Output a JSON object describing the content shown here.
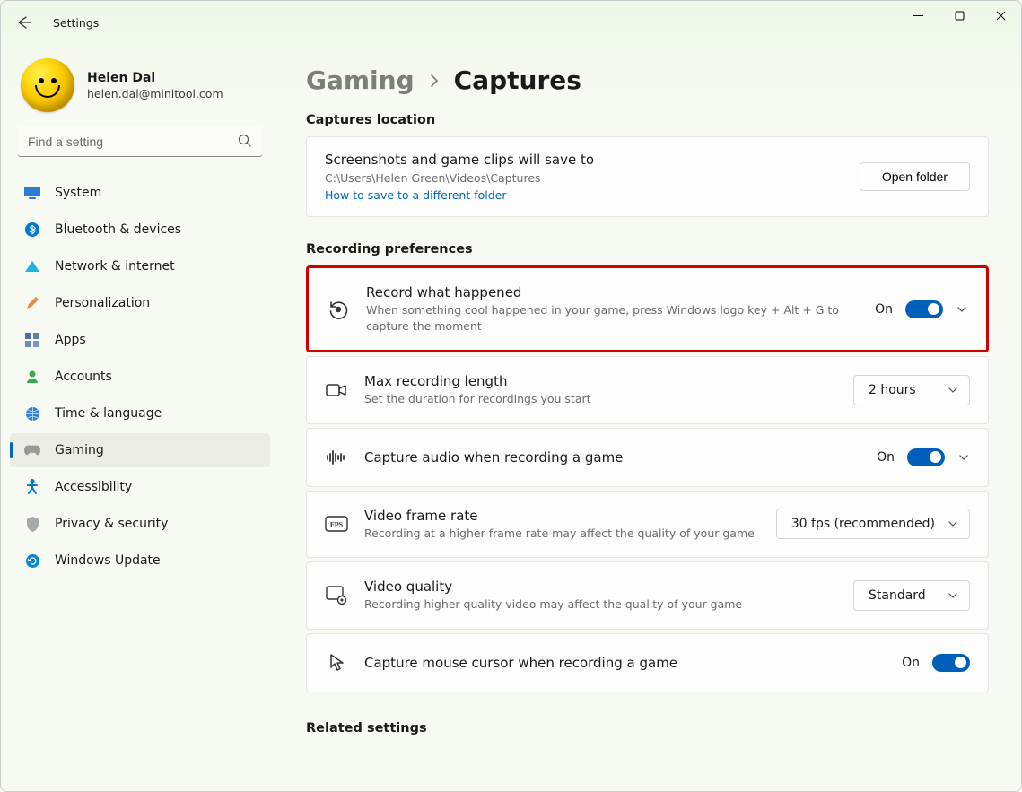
{
  "app": {
    "title": "Settings"
  },
  "profile": {
    "name": "Helen Dai",
    "email": "helen.dai@minitool.com"
  },
  "search": {
    "placeholder": "Find a setting"
  },
  "sidebar": {
    "items": [
      {
        "label": "System",
        "icon": "monitor"
      },
      {
        "label": "Bluetooth & devices",
        "icon": "bluetooth"
      },
      {
        "label": "Network & internet",
        "icon": "wifi"
      },
      {
        "label": "Personalization",
        "icon": "brush"
      },
      {
        "label": "Apps",
        "icon": "apps"
      },
      {
        "label": "Accounts",
        "icon": "person"
      },
      {
        "label": "Time & language",
        "icon": "globe"
      },
      {
        "label": "Gaming",
        "icon": "gamepad",
        "active": true
      },
      {
        "label": "Accessibility",
        "icon": "accessibility"
      },
      {
        "label": "Privacy & security",
        "icon": "shield"
      },
      {
        "label": "Windows Update",
        "icon": "update"
      }
    ]
  },
  "breadcrumb": {
    "parent": "Gaming",
    "current": "Captures"
  },
  "sections": {
    "location_header": "Captures location",
    "location": {
      "title": "Screenshots and game clips will save to",
      "path": "C:\\Users\\Helen Green\\Videos\\Captures",
      "link": "How to save to a different folder",
      "open_button": "Open folder"
    },
    "recording_header": "Recording preferences",
    "rows": [
      {
        "title": "Record what happened",
        "sub": "When something cool happened in your game, press Windows logo key + Alt + G to capture the moment",
        "value_label": "On",
        "toggle": true,
        "expandable": true,
        "highlight": true
      },
      {
        "title": "Max recording length",
        "sub": "Set the duration for recordings you start",
        "select_value": "2 hours"
      },
      {
        "title": "Capture audio when recording a game",
        "value_label": "On",
        "toggle": true,
        "expandable": true
      },
      {
        "title": "Video frame rate",
        "sub": "Recording at a higher frame rate may affect the quality of your game",
        "select_value": "30 fps (recommended)",
        "select_wide": true
      },
      {
        "title": "Video quality",
        "sub": "Recording higher quality video may affect the quality of your game",
        "select_value": "Standard"
      },
      {
        "title": "Capture mouse cursor when recording a game",
        "value_label": "On",
        "toggle": true
      }
    ],
    "related_header": "Related settings"
  },
  "icons": {
    "system": "#2b7cd3",
    "bluetooth": "#0078d4",
    "wifi": "#20b2e0",
    "brush": "#e88a3c",
    "apps": "#4a6fa5",
    "person": "#3aa84f",
    "globe": "#2f7fd8",
    "gaming": "#888",
    "accessibility": "#0078d4",
    "shield": "#8a8a8a",
    "update": "#0a84d6"
  }
}
